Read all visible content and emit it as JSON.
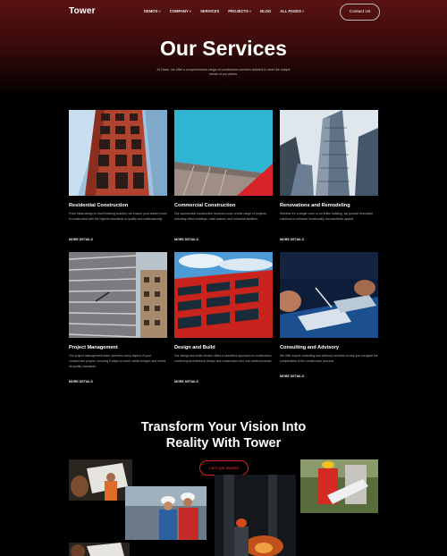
{
  "header": {
    "logo": "Tower",
    "nav": [
      {
        "label": "DEMOS",
        "dropdown": true
      },
      {
        "label": "COMPANY",
        "dropdown": true
      },
      {
        "label": "SERVICES",
        "dropdown": false
      },
      {
        "label": "PROJECTS",
        "dropdown": true
      },
      {
        "label": "BLOG",
        "dropdown": false
      },
      {
        "label": "ALL PAGES",
        "dropdown": true
      }
    ],
    "contact_label": "Contact Us"
  },
  "hero": {
    "title": "Our Services",
    "subtitle": "At Tower, we offer a comprehensive range of construction services tailored to meet the unique needs of our clients."
  },
  "services": [
    {
      "title": "Residential Construction",
      "text": "From initial design to final finishing touches, we ensure your dream home is constructed with the highest standards of quality and craftsmanship.",
      "link": "MORE DETAILS"
    },
    {
      "title": "Commercial Construction",
      "text": "Our commercial construction services cover a wide range of projects, including office buildings, retail spaces, and industrial facilities.",
      "link": "MORE DETAILS"
    },
    {
      "title": "Renovations and Remodeling",
      "text": "Whether it's a single room or an entire building, we provide innovative solutions to enhance functionality and aesthetic appeal.",
      "link": "MORE DETAILS"
    },
    {
      "title": "Project Management",
      "text": "Our project management team oversees every aspect of your construction project, ensuring it stays on track, within budget, and meets all quality standards.",
      "link": "MORE DETAILS"
    },
    {
      "title": "Design and Build",
      "text": "Our design and build service offers a seamless approach to construction, combining architectural design and construction into one unified process.",
      "link": "MORE DETAILS"
    },
    {
      "title": "Consulting and Advisory",
      "text": "We offer expert consulting and advisory services to help you navigate the complexities of the construction process.",
      "link": "MORE DETAILS"
    }
  ],
  "cta": {
    "line1": "Transform Your Vision Into",
    "line2": "Reality With Tower",
    "button": "Let's get started"
  },
  "colors": {
    "accent": "#e02020",
    "hero_top": "#5a1212",
    "background": "#000000"
  }
}
